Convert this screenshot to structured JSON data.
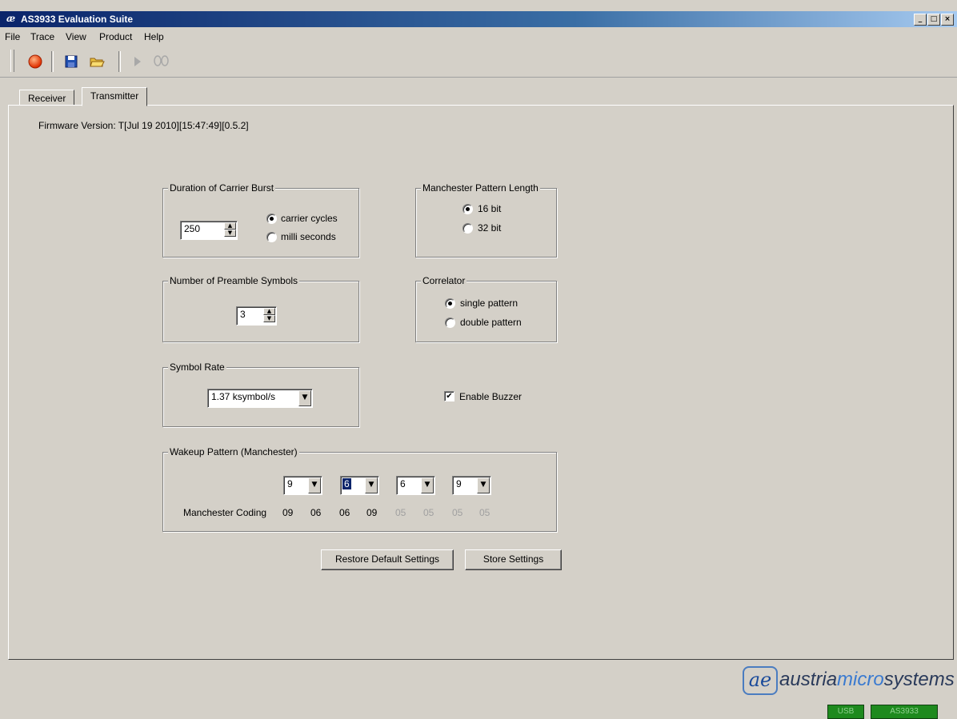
{
  "window": {
    "title": "AS3933 Evaluation Suite",
    "controls": [
      "_",
      "□",
      "×"
    ]
  },
  "menu": {
    "items": [
      "File",
      "Trace",
      "View",
      "Product",
      "Help"
    ]
  },
  "toolbar": {
    "icons": [
      "record-icon",
      "save-icon",
      "open-folder-icon",
      "play-icon",
      "footprints-icon"
    ]
  },
  "tabs": [
    {
      "label": "Receiver",
      "active": false
    },
    {
      "label": "Transmitter",
      "active": true
    }
  ],
  "firmware": "Firmware Version: T[Jul 19 2010][15:47:49][0.5.2]",
  "carrier_burst": {
    "title": "Duration of Carrier Burst",
    "value": "250",
    "options": [
      "carrier cycles",
      "milli seconds"
    ],
    "selected": "carrier cycles"
  },
  "manchester_length": {
    "title": "Manchester Pattern Length",
    "options": [
      "16 bit",
      "32 bit"
    ],
    "selected": "16 bit"
  },
  "preamble": {
    "title": "Number of Preamble Symbols",
    "value": "3"
  },
  "correlator": {
    "title": "Correlator",
    "options": [
      "single pattern",
      "double pattern"
    ],
    "selected": "single pattern"
  },
  "symbol_rate": {
    "title": "Symbol Rate",
    "value": "1.37 ksymbol/s"
  },
  "buzzer": {
    "label": "Enable Buzzer",
    "checked": true
  },
  "wakeup": {
    "title": "Wakeup Pattern (Manchester)",
    "selects": [
      "9",
      "6",
      "6",
      "9"
    ],
    "coding_label": "Manchester Coding",
    "codes": [
      "09",
      "06",
      "06",
      "09",
      "05",
      "05",
      "05",
      "05"
    ]
  },
  "buttons": {
    "restore": "Restore Default Settings",
    "store": "Store Settings"
  },
  "logo": {
    "icon_text": "ae",
    "brand_pre": "austria",
    "brand_micro": "micro",
    "brand_post": "systems"
  },
  "statusbar": {
    "usb": "USB",
    "device": "AS3933"
  }
}
